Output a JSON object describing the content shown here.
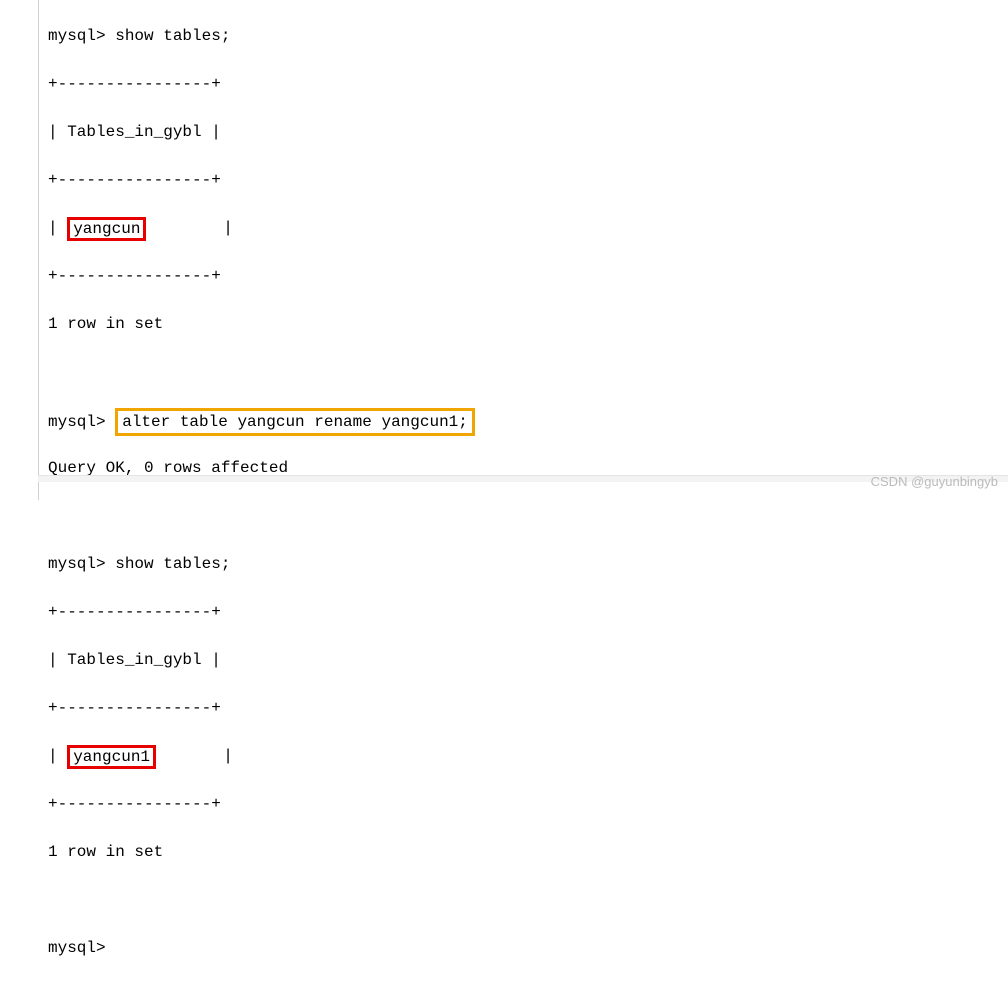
{
  "terminal": {
    "prompt": "mysql>",
    "cmd_show_tables": "show tables;",
    "border_top": "+----------------+",
    "header_row": "| Tables_in_gybl |",
    "data_row_prefix": "| ",
    "data_row_suffix": "        |",
    "data_row_suffix2": "       |",
    "table1_value": "yangcun",
    "table2_value": "yangcun1",
    "row_count": "1 row in set",
    "cmd_alter": "alter table yangcun rename yangcun1;",
    "query_ok": "Query OK, 0 rows affected",
    "blank": ""
  },
  "watermark": "CSDN @guyunbingyb"
}
